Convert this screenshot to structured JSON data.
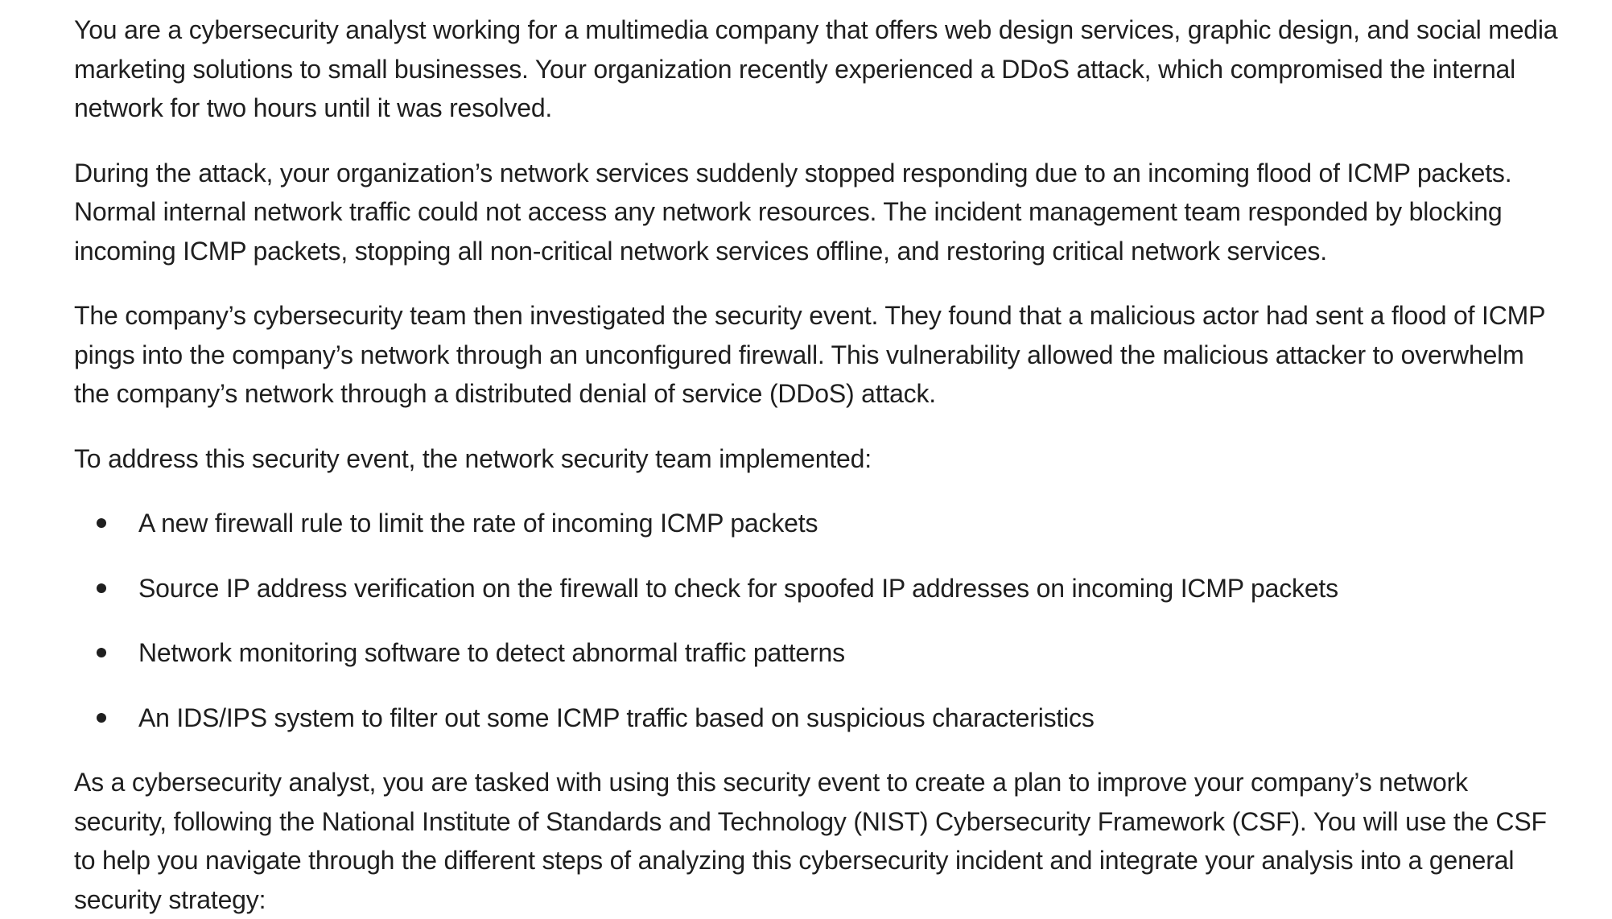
{
  "document": {
    "paragraphs_before": [
      "You are a cybersecurity analyst working for a multimedia company that offers web design services, graphic design, and social media marketing solutions to small businesses. Your organization recently experienced a DDoS attack, which compromised the internal network for two hours until it was resolved.",
      "During the attack, your organization’s network services suddenly stopped responding due to an incoming flood of ICMP packets. Normal internal network traffic could not access any network resources. The incident management team responded by blocking incoming ICMP packets, stopping all non-critical network services offline, and restoring critical network services.",
      "The company’s cybersecurity team then investigated the security event. They found that a malicious actor had sent a flood of ICMP pings into the company’s network through an unconfigured firewall. This vulnerability allowed the malicious attacker to overwhelm the company’s network through a distributed denial of service (DDoS) attack.",
      "To address this security event, the network security team implemented:"
    ],
    "bullets": [
      "A new firewall rule to limit the rate of incoming ICMP packets",
      "Source IP address verification on the firewall to check for spoofed IP addresses on incoming ICMP packets",
      "Network monitoring software to detect abnormal traffic patterns",
      "An IDS/IPS system to filter out some ICMP traffic based on suspicious characteristics"
    ],
    "paragraph_after": "As a cybersecurity analyst, you are tasked with using this security event to create a plan to improve your company’s network security, following the National Institute of Standards and Technology (NIST) Cybersecurity Framework (CSF). You will use the CSF to help you navigate through the different steps of analyzing this cybersecurity incident and integrate your analysis into a general security strategy:"
  }
}
